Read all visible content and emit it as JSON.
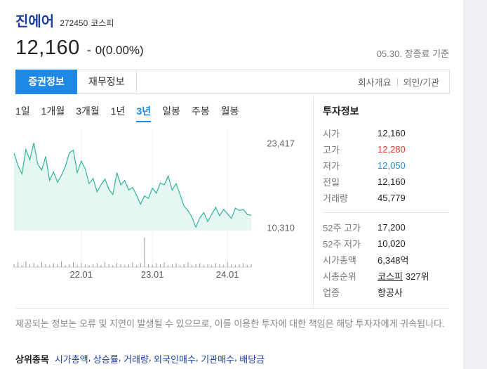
{
  "stock": {
    "name": "진에어",
    "code": "272450",
    "market": "코스피",
    "price": "12,160",
    "dash": "-",
    "change": "0(0.00%)",
    "date_note": "05.30. 장종료 기준"
  },
  "tabs": [
    {
      "label": "증권정보"
    },
    {
      "label": "재무정보"
    }
  ],
  "tab_links": [
    "회사개요",
    "외인/기관"
  ],
  "periods": [
    "1일",
    "1개월",
    "3개월",
    "1년",
    "3년",
    "일봉",
    "주봉",
    "월봉"
  ],
  "active_period": "3년",
  "chart_data": {
    "type": "area",
    "ylabels": [
      "23,417",
      "10,310"
    ],
    "xlabels": [
      "22.01",
      "23.01",
      "24.01"
    ],
    "ylim": [
      9800,
      24000
    ],
    "price_series": [
      21800,
      19900,
      18600,
      22400,
      20800,
      23417,
      20100,
      19200,
      21300,
      17600,
      18900,
      17300,
      18400,
      19800,
      21900,
      22300,
      18800,
      20600,
      19400,
      17100,
      17900,
      15800,
      16900,
      17800,
      16200,
      15400,
      18800,
      16900,
      17600,
      16100,
      16500,
      15300,
      13900,
      15200,
      14800,
      16400,
      15600,
      17200,
      16900,
      18300,
      16100,
      17100,
      15400,
      13600,
      12900,
      11900,
      10310,
      11800,
      12600,
      11200,
      12300,
      13400,
      12100,
      13100,
      12400,
      11700,
      13300,
      12900,
      13100,
      12300,
      12160
    ],
    "volume_series": [
      3,
      5,
      2,
      6,
      3,
      4,
      2,
      5,
      3,
      2,
      4,
      3,
      6,
      2,
      3,
      5,
      2,
      4,
      3,
      2,
      3,
      4,
      2,
      5,
      3,
      2,
      4,
      3,
      2,
      3,
      5,
      2,
      4,
      30,
      3,
      2,
      4,
      3,
      5,
      2,
      3,
      4,
      2,
      3,
      5,
      2,
      3,
      4,
      2,
      3,
      2,
      4,
      3,
      2,
      5,
      3,
      2,
      3,
      4,
      2,
      3
    ],
    "volume_max": 30,
    "colors": {
      "line": "#2fb59a",
      "fill": "#e6f7f3",
      "volume": "#999999"
    }
  },
  "info": {
    "title": "투자정보",
    "rows_top": [
      {
        "label": "시가",
        "value": "12,160",
        "tone": ""
      },
      {
        "label": "고가",
        "value": "12,280",
        "tone": "up"
      },
      {
        "label": "저가",
        "value": "12,050",
        "tone": "down"
      },
      {
        "label": "전일",
        "value": "12,160",
        "tone": ""
      },
      {
        "label": "거래량",
        "value": "45,779",
        "tone": ""
      }
    ],
    "rows_bottom": [
      {
        "label": "52주 고가",
        "value": "17,200"
      },
      {
        "label": "52주 저가",
        "value": "10,020"
      },
      {
        "label": "시가총액",
        "value": "6,348억"
      },
      {
        "label": "시총순위",
        "value_link": "코스피",
        "value": "327위"
      },
      {
        "label": "업종",
        "value": "항공사"
      }
    ]
  },
  "disclaimer": "제공되는 정보는 오류 및 지연이 발생될 수 있으므로, 이를 이용한 투자에 대한 책임은 해당 투자자에게 귀속됩니다.",
  "related": {
    "title": "상위종목",
    "links": [
      "시가총액",
      "상승률",
      "거래량",
      "외국인매수",
      "기관매수",
      "배당금"
    ]
  }
}
